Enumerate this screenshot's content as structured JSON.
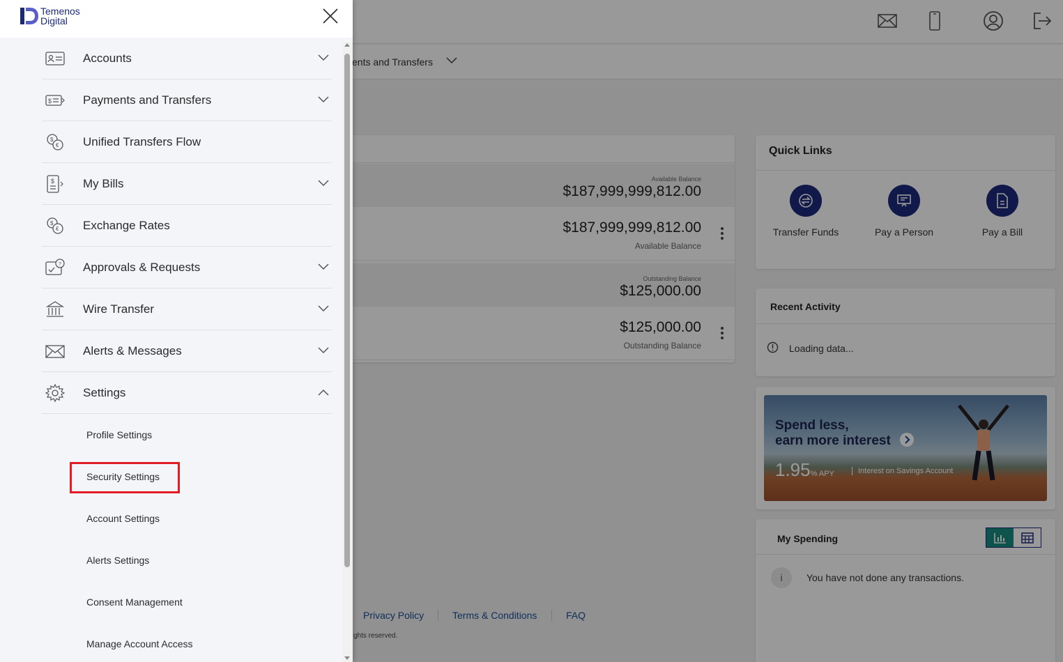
{
  "brand": {
    "line1": "Temenos",
    "line2": "Digital",
    "color": "#1c2a7a"
  },
  "top_icons": [
    "mail-icon",
    "mobile-icon",
    "profile-icon",
    "logout-icon"
  ],
  "subnav": {
    "label": "ents and Transfers"
  },
  "accounts": {
    "group1": {
      "label": "Available Balance",
      "amount": "$187,999,999,812.00"
    },
    "row1": {
      "amount": "$187,999,999,812.00",
      "sub": "Available Balance"
    },
    "group2": {
      "label": "Outstanding Balance",
      "amount": "$125,000.00"
    },
    "row2": {
      "amount": "$125,000.00",
      "sub": "Outstanding Balance"
    }
  },
  "quick_links": {
    "title": "Quick Links",
    "items": [
      {
        "label": "Transfer Funds",
        "icon": "transfer-icon"
      },
      {
        "label": "Pay a Person",
        "icon": "pay-person-icon"
      },
      {
        "label": "Pay a Bill",
        "icon": "bill-icon"
      }
    ]
  },
  "recent_activity": {
    "title": "Recent Activity",
    "status": "Loading data..."
  },
  "promo": {
    "title_line1": "Spend less,",
    "title_line2": "earn more interest",
    "apy_value": "1.95",
    "apy_unit": "% APY",
    "apy_note": "Interest on Savings Account"
  },
  "spending": {
    "title": "My Spending",
    "message": "You have not done any transactions.",
    "info": "i"
  },
  "footer": {
    "links": [
      "Privacy Policy",
      "Terms & Conditions",
      "FAQ"
    ],
    "copyright": "ghts reserved."
  },
  "sidemenu": {
    "items": [
      {
        "label": "Accounts",
        "icon": "accounts-icon",
        "chevron": "down"
      },
      {
        "label": "Payments and Transfers",
        "icon": "payments-icon",
        "chevron": "down"
      },
      {
        "label": "Unified Transfers Flow",
        "icon": "unified-transfers-icon",
        "chevron": ""
      },
      {
        "label": "My Bills",
        "icon": "bills-icon",
        "chevron": "down"
      },
      {
        "label": "Exchange Rates",
        "icon": "exchange-rates-icon",
        "chevron": ""
      },
      {
        "label": "Approvals & Requests",
        "icon": "approvals-icon",
        "chevron": "down"
      },
      {
        "label": "Wire Transfer",
        "icon": "wire-transfer-icon",
        "chevron": "down"
      },
      {
        "label": "Alerts & Messages",
        "icon": "alerts-messages-icon",
        "chevron": "down"
      },
      {
        "label": "Settings",
        "icon": "settings-icon",
        "chevron": "up"
      }
    ],
    "settings_sub": [
      {
        "label": "Profile Settings"
      },
      {
        "label": "Security Settings",
        "highlighted": true
      },
      {
        "label": "Account Settings"
      },
      {
        "label": "Alerts Settings"
      },
      {
        "label": "Consent Management"
      },
      {
        "label": "Manage Account Access"
      }
    ]
  },
  "colors": {
    "navy": "#1c2a7a",
    "highlight": "#e21c24",
    "teal": "#1a8a80"
  }
}
